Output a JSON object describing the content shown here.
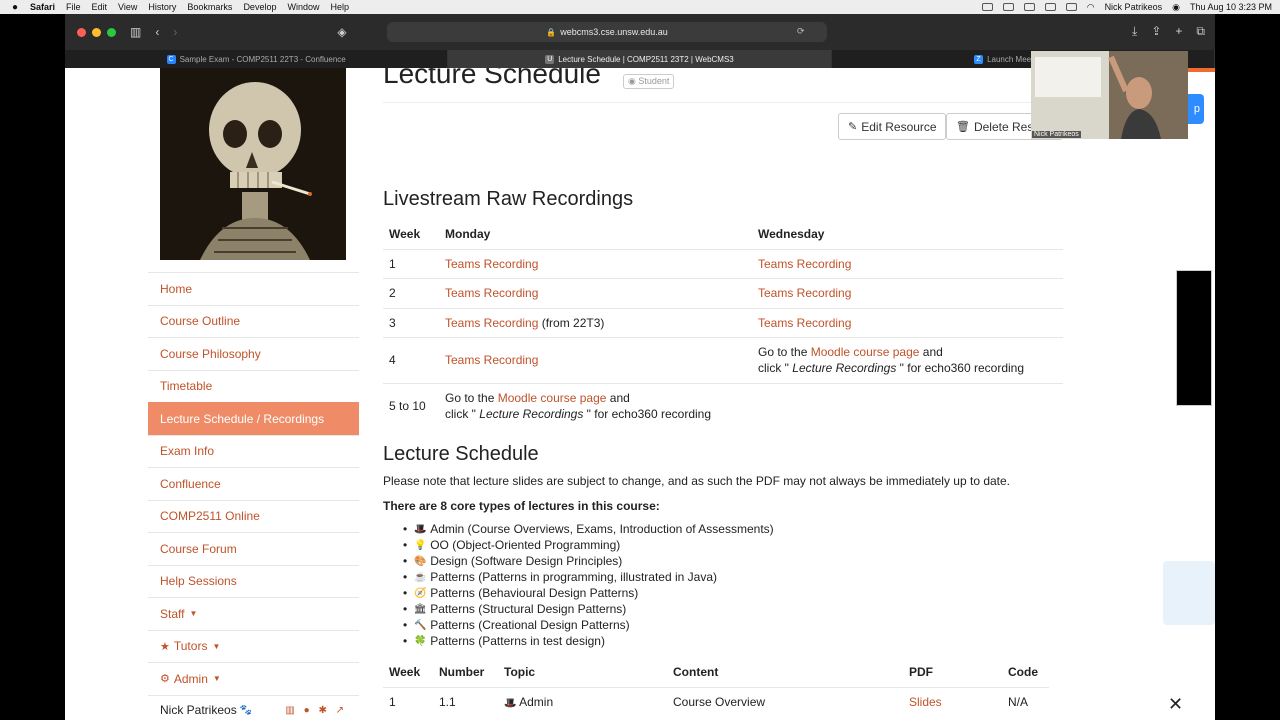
{
  "menubar": {
    "app": "Safari",
    "items": [
      "File",
      "Edit",
      "View",
      "History",
      "Bookmarks",
      "Develop",
      "Window",
      "Help"
    ],
    "user": "Nick Patrikeos",
    "datetime": "Thu Aug 10  3:23 PM"
  },
  "browser": {
    "address": "webcms3.cse.unsw.edu.au",
    "tabs": [
      {
        "label": "Sample Exam - COMP2511 22T3 - Confluence",
        "fav": "C",
        "fav_color": "#2684ff"
      },
      {
        "label": "Lecture Schedule | COMP2511 23T2 | WebCMS3",
        "fav": "U",
        "fav_color": "#777777"
      },
      {
        "label": "Launch Meeting - Zoom",
        "fav": "Z",
        "fav_color": "#2d8cff"
      }
    ]
  },
  "sidebar": {
    "nav": [
      {
        "label": "Home",
        "name": "nav-home"
      },
      {
        "label": "Course Outline",
        "name": "nav-course-outline"
      },
      {
        "label": "Course Philosophy",
        "name": "nav-course-philosophy"
      },
      {
        "label": "Timetable",
        "name": "nav-timetable"
      },
      {
        "label": "Lecture Schedule / Recordings",
        "name": "nav-lecture-schedule",
        "active": true
      },
      {
        "label": "Exam Info",
        "name": "nav-exam-info"
      },
      {
        "label": "Confluence",
        "name": "nav-confluence"
      },
      {
        "label": "COMP2511 Online",
        "name": "nav-comp2511-online"
      },
      {
        "label": "Course Forum",
        "name": "nav-course-forum"
      },
      {
        "label": "Help Sessions",
        "name": "nav-help-sessions"
      },
      {
        "label": "Staff",
        "name": "nav-staff",
        "caret": true
      },
      {
        "label": "Tutors",
        "name": "nav-tutors",
        "caret": true,
        "icon": "★"
      },
      {
        "label": "Admin",
        "name": "nav-admin",
        "caret": true,
        "icon": "⚙"
      }
    ],
    "user": "Nick Patrikeos"
  },
  "main": {
    "title": "Lecture Schedule",
    "badge": "Student",
    "edit_button": "Edit Resource",
    "delete_button": "Delete Resource",
    "recordings_heading": "Livestream Raw Recordings",
    "recordings_headers": [
      "Week",
      "Monday",
      "Wednesday"
    ],
    "link_teams": "Teams Recording",
    "from_note": " (from 22T3)",
    "goto_prefix": "Go to the ",
    "moodle_link": "Moodle course page",
    "goto_suffix": " and",
    "click_prefix": "click \"",
    "click_italic": " Lecture Recordings ",
    "click_suffix": "\" for echo360 recording",
    "weeks": [
      "1",
      "2",
      "3",
      "4",
      "5 to 10"
    ],
    "schedule_heading": "Lecture Schedule",
    "schedule_note": "Please note that lecture slides are subject to change, and as such the PDF may not always be immediately up to date.",
    "types_heading": "There are 8 core types of lectures in this course:",
    "lecture_types": [
      {
        "emoji": "🎩",
        "text": "Admin (Course Overviews, Exams, Introduction of Assessments)"
      },
      {
        "emoji": "💡",
        "text": "OO (Object-Oriented Programming)"
      },
      {
        "emoji": "🎨",
        "text": "Design (Software Design Principles)"
      },
      {
        "emoji": "☕",
        "text": "Patterns (Patterns in programming, illustrated in Java)"
      },
      {
        "emoji": "🧭",
        "text": "Patterns (Behavioural Design Patterns)"
      },
      {
        "emoji": "🏛",
        "text": "Patterns (Structural Design Patterns)"
      },
      {
        "emoji": "🔨",
        "text": "Patterns (Creational Design Patterns)"
      },
      {
        "emoji": "🍀",
        "text": "Patterns (Patterns in test design)"
      }
    ],
    "schedule_headers": [
      "Week",
      "Number",
      "Topic",
      "Content",
      "PDF",
      "Code"
    ],
    "schedule_rows": [
      {
        "week": "1",
        "number": "1.1",
        "emoji": "🎩",
        "topic": "Admin",
        "content": "Course Overview",
        "pdf": "Slides",
        "code": "N/A"
      }
    ]
  },
  "webcam": {
    "label": "Nick Patrikeos"
  },
  "colors": {
    "link": "#c0532a",
    "active_nav": "#ef8c67"
  }
}
